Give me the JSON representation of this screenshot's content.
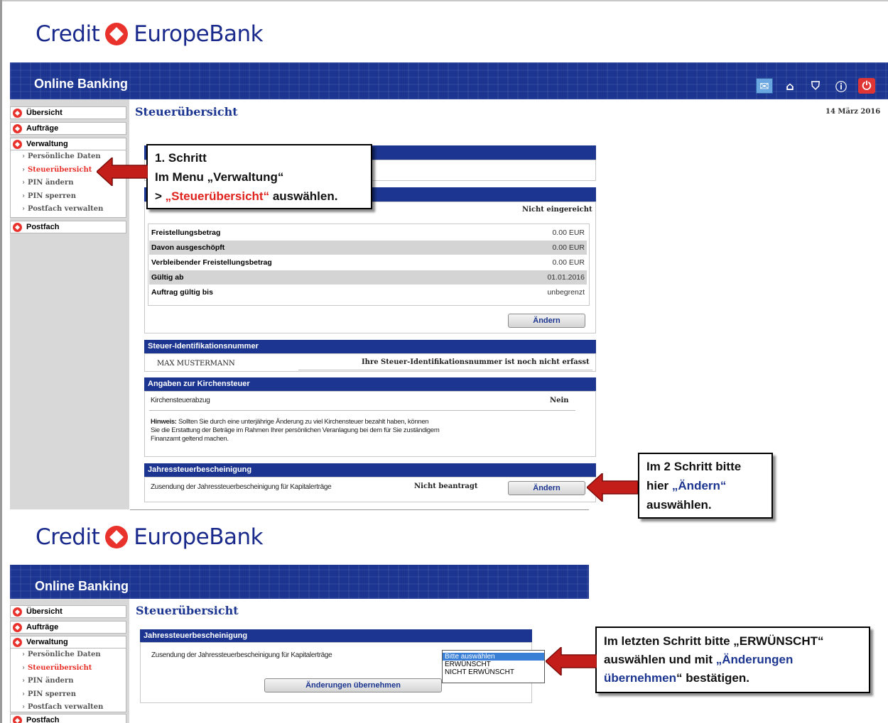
{
  "brand": {
    "credit": "Credit",
    "europe": "Europe",
    "bank": "Bank"
  },
  "banner": {
    "title": "Online Banking"
  },
  "icons": [
    "mail-icon",
    "home-icon",
    "shield-icon",
    "info-icon",
    "logout-icon"
  ],
  "menu": {
    "uebersicht": "Übersicht",
    "auftraege": "Aufträge",
    "verwaltung": "Verwaltung",
    "sub": [
      "Persönliche Daten",
      "Steuerübersicht",
      "PIN ändern",
      "PIN sperren",
      "Postfach verwalten"
    ],
    "postfach": "Postfach"
  },
  "page": {
    "title": "Steuerübersicht",
    "date": "14 März 2016"
  },
  "freistellung": {
    "status": "Nicht eingereicht",
    "rows": [
      {
        "label": "Freistellungsbetrag",
        "value": "0.00 EUR"
      },
      {
        "label": "Davon ausgeschöpft",
        "value": "0.00 EUR"
      },
      {
        "label": "Verbleibender Freistellungsbetrag",
        "value": "0.00 EUR"
      },
      {
        "label": "Gültig ab",
        "value": "01.01.2016"
      },
      {
        "label": "Auftrag gültig bis",
        "value": "unbegrenzt"
      }
    ],
    "button": "Ändern"
  },
  "steuer_id": {
    "header": "Steuer-Identifikationsnummer",
    "name": "MAX MUSTERMANN",
    "status": "Ihre Steuer-Identifikationsnummer ist noch nicht erfasst"
  },
  "kirchensteuer": {
    "header": "Angaben zur Kirchensteuer",
    "label": "Kirchensteuerabzug",
    "value": "Nein",
    "hint_label": "Hinweis:",
    "hint_line1": "Sollten Sie durch eine unterjährige Änderung zu viel Kirchensteuer bezahlt haben, können",
    "hint_line2": "Sie die Erstattung der Beträge im Rahmen Ihrer persönlichen Veranlagung bei dem für Sie zuständigem",
    "hint_line3": "Finanzamt geltend machen."
  },
  "jahressteuer": {
    "header": "Jahressteuerbescheinigung",
    "label": "Zusendung der Jahressteuerbescheinigung für Kapitalerträge",
    "status": "Nicht beantragt",
    "button": "Ändern"
  },
  "second": {
    "options": [
      "Bitte auswählen",
      "ERWÜNSCHT",
      "NICHT ERWÜNSCHT"
    ],
    "submit": "Änderungen übernehmen"
  },
  "callouts": {
    "c1_l1": "1. Schritt",
    "c1_l2": "Im Menu „Verwaltung“",
    "c1_l3a": "> ",
    "c1_l3b": "„Steuerübersicht“",
    "c1_l3c": " auswählen.",
    "c2_l1": "Im 2 Schritt bitte",
    "c2_l2a": "hier ",
    "c2_l2b": "„Ändern“",
    "c2_l3": "auswählen.",
    "c3_l1": "Im letzten Schritt bitte „ERWÜNSCHT“",
    "c3_l2a": "auswählen und mit ",
    "c3_l2b": "„Änderungen",
    "c3_l3a": "übernehmen",
    "c3_l3b": "“ bestätigen."
  }
}
